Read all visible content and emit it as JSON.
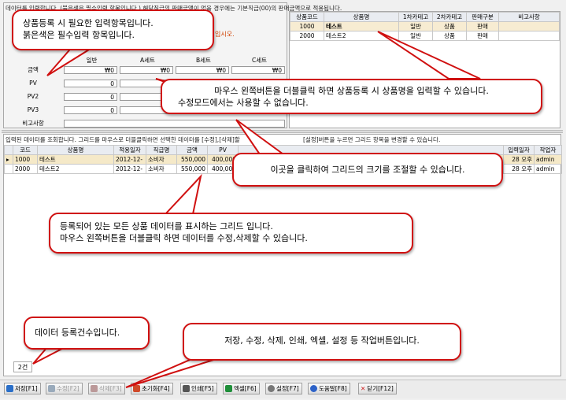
{
  "entry_header": "데이터를 입력합니다. (붉은색은 필수입력 항목입니다.) 해당직급의 판매금액이 없을 경우에는 기본직급(00)의 판매금액으로 적용됩니다.",
  "entry_note_fragment": "입시오.",
  "price_table": {
    "columns": [
      "일반",
      "A세트",
      "B세트",
      "C세트"
    ],
    "rows": [
      {
        "label": "금액",
        "values": [
          "₩0",
          "₩0",
          "₩0",
          "₩0"
        ]
      },
      {
        "label": "PV",
        "values": [
          "0",
          "0",
          "0",
          "0"
        ]
      },
      {
        "label": "PV2",
        "values": [
          "0",
          "0",
          "0",
          "0"
        ]
      },
      {
        "label": "PV3",
        "values": [
          "0",
          "0",
          "0",
          "0"
        ]
      }
    ],
    "remark_label": "비고사항"
  },
  "sub_grid": {
    "columns": [
      "상품코드",
      "상품명",
      "1차카테고",
      "2차카테고",
      "판매구분",
      "비고사항"
    ],
    "rows": [
      [
        "1000",
        "테스트",
        "일반",
        "상품",
        "판매",
        ""
      ],
      [
        "2000",
        "테스트2",
        "일반",
        "상품",
        "판매",
        ""
      ]
    ]
  },
  "list_header_left": "입력된 데이터를 조회합니다. 그리드를 마우스로 더블클릭하면 선택한 데이터를 [수정],[삭제]할",
  "list_header_right": "[설정]버튼을 누르면 그리드 항목을 변경할 수 있습니다.",
  "main_grid": {
    "columns": [
      "코드",
      "상품명",
      "적용일자",
      "직급명",
      "금액",
      "PV",
      "입력일자",
      "작업자"
    ],
    "rows": [
      {
        "code": "1000",
        "name": "테스트",
        "date": "2012-12-",
        "rank": "소비자",
        "price": "550,000",
        "pv": "400,000",
        "input_date": "28 오후",
        "worker": "admin"
      },
      {
        "code": "2000",
        "name": "테스트2",
        "date": "2012-12-",
        "rank": "소비자",
        "price": "550,000",
        "pv": "400,000",
        "input_date": "28 오후",
        "worker": "admin"
      }
    ]
  },
  "record_count": "2건",
  "toolbar": [
    {
      "label": "저장[F1]",
      "icon": "save-icon",
      "enabled": true,
      "color": "#2a6fc9"
    },
    {
      "label": "수정[F2]",
      "icon": "edit-icon",
      "enabled": false,
      "color": "#9ab"
    },
    {
      "label": "삭제[F3]",
      "icon": "delete-icon",
      "enabled": false,
      "color": "#b99"
    },
    {
      "label": "초기화[F4]",
      "icon": "reset-icon",
      "enabled": true,
      "color": "#d04a2a"
    },
    {
      "label": "인쇄[F5]",
      "icon": "print-icon",
      "enabled": true,
      "color": "#555"
    },
    {
      "label": "엑셀[F6]",
      "icon": "excel-icon",
      "enabled": true,
      "color": "#1f8f3a"
    },
    {
      "label": "설정[F7]",
      "icon": "gear-icon",
      "enabled": true,
      "color": "#777"
    },
    {
      "label": "도움말[F8]",
      "icon": "help-icon",
      "enabled": true,
      "color": "#2d62c8"
    },
    {
      "label": "닫기[F12]",
      "icon": "close-icon",
      "enabled": true,
      "color": "#d01818"
    }
  ],
  "callouts": {
    "entry": [
      "상품등록 시 필요한 입력항목입니다.",
      "붉은색은 필수입력 항목입니다."
    ],
    "doubleclick_sub": [
      "마우스 왼쪽버튼을 더블클릭 하면 상품등록 시 상품명을 입력할 수 있습니다.",
      "수정모드에서는 사용할 수 없습니다."
    ],
    "resize": [
      "이곳을 클릭하여 그리드의 크기를 조절할 수 있습니다."
    ],
    "grid": [
      "등록되어 있는 모든 상품 데이터를 표시하는 그리드 입니다.",
      "마우스 왼쪽버튼을 더블클릭 하면 데이터를 수정,삭제할 수 있습니다."
    ],
    "count": [
      "데이터 등록건수입니다."
    ],
    "buttons": [
      "저장, 수정, 삭제, 인쇄, 엑셀, 설정 등 작업버튼입니다."
    ]
  },
  "colors": {
    "callout_border": "#d01010",
    "selected_row": "#f5e9c8",
    "header_bg": "#e9ecf1"
  }
}
